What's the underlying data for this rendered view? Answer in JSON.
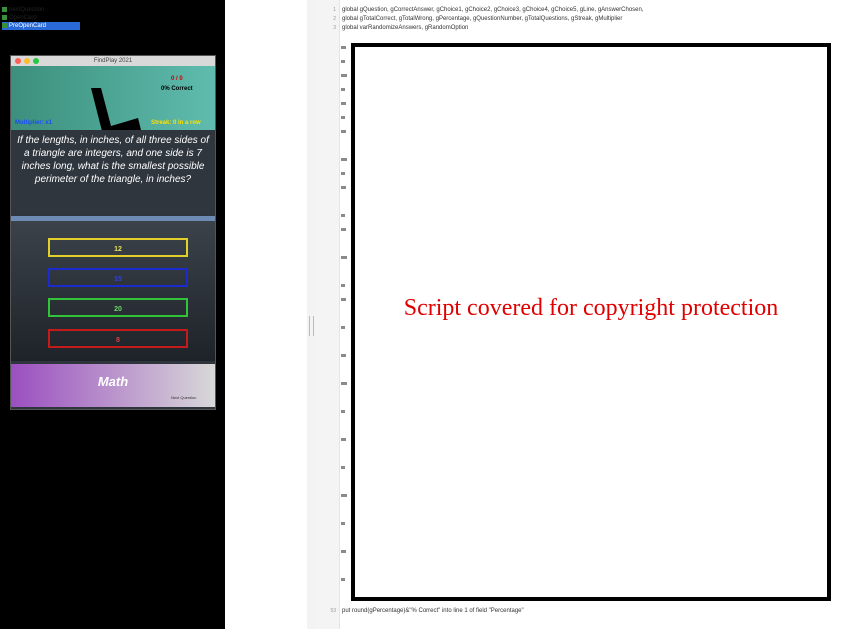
{
  "app_window": {
    "title": "FindPlay 2021",
    "score": "0 / 0",
    "correct": "0% Correct",
    "multiplier": "Multiplier: x1",
    "streak": "Streak: 0 in a row",
    "question": "If the lengths, in inches, of all three sides of a triangle are integers, and one side is 7 inches long, what is the smallest possible perimeter of the triangle, in inches?",
    "answers": [
      "12",
      "15",
      "20",
      "8"
    ],
    "category": "Math",
    "category_note": "Next Question"
  },
  "stack_tree": {
    "items": [
      "nextQuestion",
      "OpenCard",
      "PreOpenCard"
    ]
  },
  "code": {
    "lines": [
      {
        "num": "1",
        "text": "global gQuestion, gCorrectAnswer, gChoice1, gChoice2, gChoice3, gChoice4, gChoice5, gLine, gAnswerChosen,"
      },
      {
        "num": "2",
        "text": "global gTotalCorrect, gTotalWrong, gPercentage, gQuestionNumber, gTotalQuestions, gStreak, gMultiplier"
      },
      {
        "num": "3",
        "text": "global varRandomizeAnswers, gRandomOption"
      },
      {
        "num": "53",
        "text": "put round(gPercentage)&\"% Correct\" into line 1 of field \"Percentage\""
      }
    ]
  },
  "cover": {
    "text": "Script covered for copyright protection"
  }
}
